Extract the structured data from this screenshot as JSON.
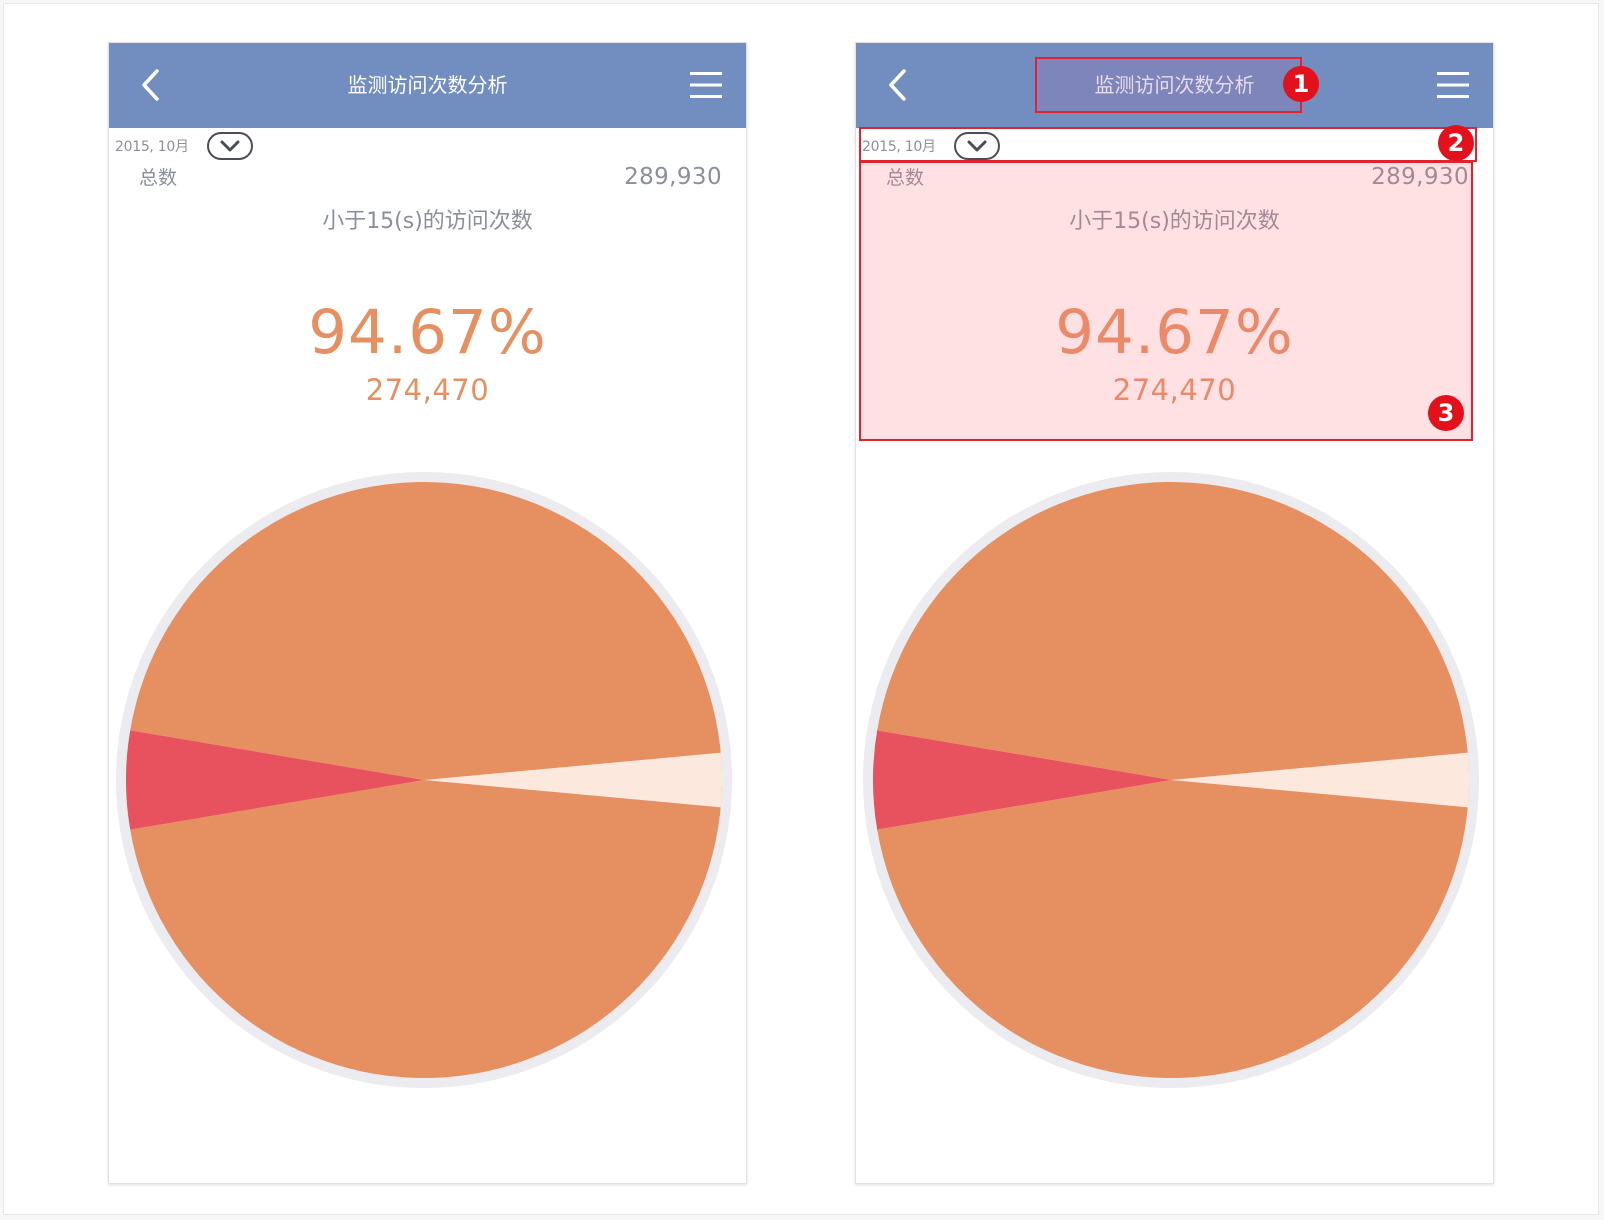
{
  "screens": [
    {
      "id": "left",
      "header": {
        "title": "监测访问次数分析",
        "back_icon": "chevron-left-icon",
        "menu_icon": "hamburger-menu-icon"
      },
      "date": {
        "label": "2015, 10月",
        "dropdown_icon": "chevron-down-icon"
      },
      "summary": {
        "total_label": "总数",
        "total_value": "289,930",
        "subtitle": "小于15(s)的访问次数",
        "percent": "94.67%",
        "count": "274,470"
      }
    },
    {
      "id": "right",
      "header": {
        "title": "监测访问次数分析",
        "back_icon": "chevron-left-icon",
        "menu_icon": "hamburger-menu-icon"
      },
      "date": {
        "label": "2015, 10月",
        "dropdown_icon": "chevron-down-icon"
      },
      "summary": {
        "total_label": "总数",
        "total_value": "289,930",
        "subtitle": "小于15(s)的访问次数",
        "percent": "94.67%",
        "count": "274,470"
      }
    }
  ],
  "annotations": [
    "1",
    "2",
    "3"
  ],
  "colors": {
    "header_bg": "#728dbf",
    "accent": "#e68f61",
    "slice_secondary": "#e8515e",
    "slice_tertiary": "#fce8dd",
    "pie_ring": "#ebebf0",
    "annotation_red": "#e3111c"
  },
  "chart_data": {
    "type": "pie",
    "slices": [
      {
        "value": 94.67
      },
      {
        "value": 5.33
      },
      {
        "value": 0.7
      }
    ]
  }
}
